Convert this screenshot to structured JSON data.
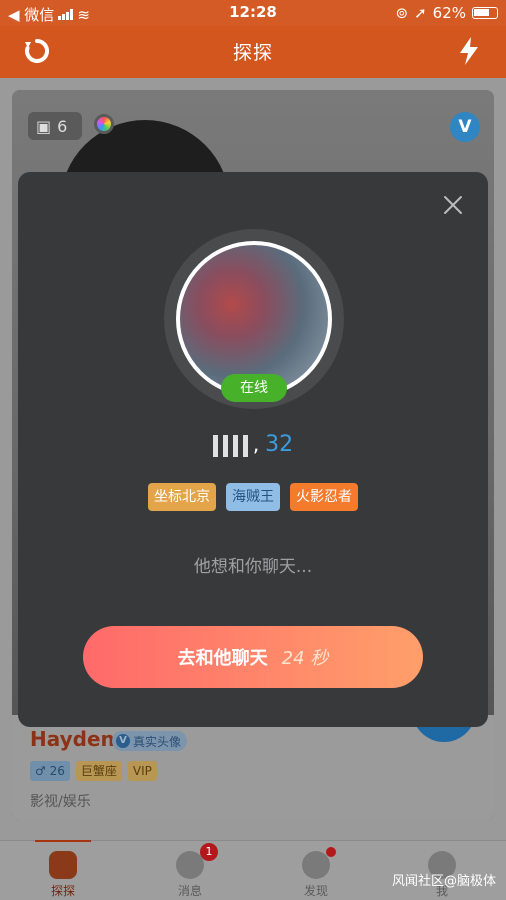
{
  "status_bar": {
    "carrier": "◀ 微信",
    "time": "12:28",
    "battery": "62%"
  },
  "header": {
    "title": "探探"
  },
  "card": {
    "photo_count": "6",
    "name": "Hayden",
    "verified_label": "真实头像",
    "sex_age": "♂ 26",
    "zodiac": "巨蟹座",
    "vip": "VIP",
    "occupation": "影视/娱乐"
  },
  "modal": {
    "status": "在线",
    "separator": ",",
    "age": "32",
    "tags": [
      "坐标北京",
      "海贼王",
      "火影忍者"
    ],
    "hint": "他想和你聊天...",
    "cta_label": "去和他聊天",
    "cta_countdown": "24 秒"
  },
  "tabbar": {
    "tabs": [
      {
        "label": "探探"
      },
      {
        "label": "消息",
        "badge": "1"
      },
      {
        "label": "发现"
      },
      {
        "label": "我"
      }
    ]
  },
  "watermark": "风闻社区@脑极体"
}
